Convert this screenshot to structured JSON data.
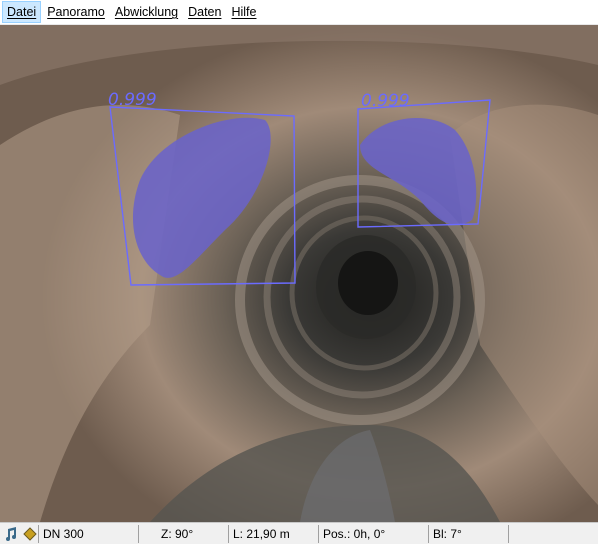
{
  "menu": {
    "items": [
      "Datei",
      "Panoramo",
      "Abwicklung",
      "Daten",
      "Hilfe"
    ],
    "active_index": 0
  },
  "detections": [
    {
      "label": "0.999",
      "color": "#6666ff"
    },
    {
      "label": "0.999",
      "color": "#6666ff"
    }
  ],
  "status": {
    "icons": [
      "music-note-icon",
      "diamond-icon"
    ],
    "diameter": "DN 300",
    "zoom": "Z: 90°",
    "length": "L: 21,90 m",
    "position": "Pos.: 0h, 0°",
    "bl": "Bl: 7°"
  }
}
